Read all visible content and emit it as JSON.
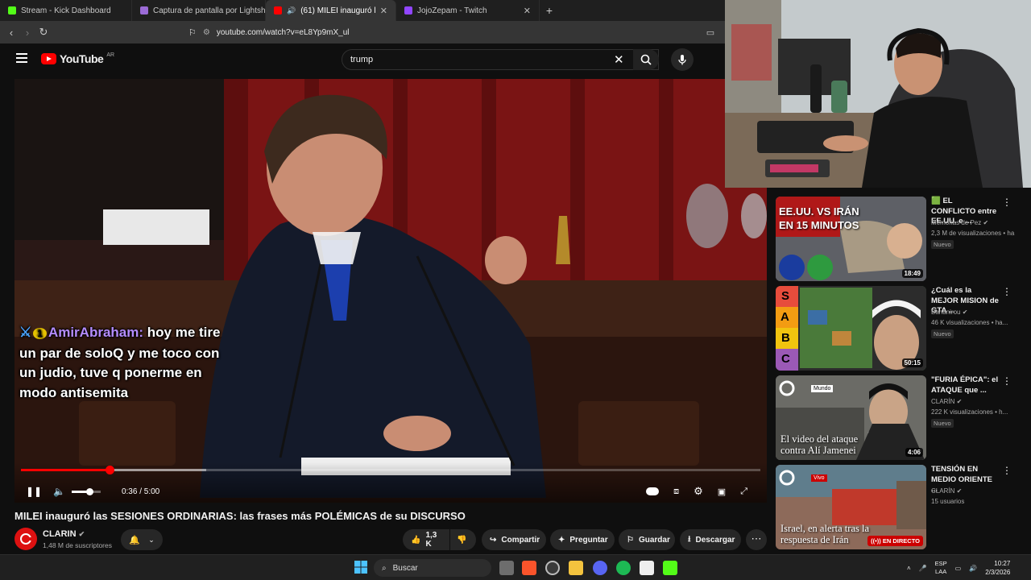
{
  "browser": {
    "tabs": [
      {
        "label": "Stream - Kick Dashboard",
        "icon": "kick-icon",
        "color": "#53fc18",
        "active": false
      },
      {
        "label": "Captura de pantalla por Lightshot",
        "icon": "feather-icon",
        "color": "#9b6bd6",
        "active": false
      },
      {
        "label": "(61) MILEI inauguró las SESIO",
        "icon": "youtube-icon",
        "color": "#ff0000",
        "active": true
      },
      {
        "label": "JojoZepam - Twitch",
        "icon": "twitch-icon",
        "color": "#9146ff",
        "active": false
      }
    ],
    "new_tab": "+",
    "url": "youtube.com/watch?v=eL8Yp9mX_ul"
  },
  "youtube": {
    "logo_text": "YouTube",
    "country": "AR",
    "search_value": "trump"
  },
  "player": {
    "time": "0:36 / 5:00",
    "played_fraction": 0.12,
    "buffered_fraction": 0.25,
    "volume_fraction": 0.6,
    "chat": {
      "user": "AmirAbraham:",
      "badge": "1",
      "message": " hoy me tire un par de soloQ y me toco con un judio, tuve q ponerme en modo antisemita"
    }
  },
  "video": {
    "title": "MILEI inauguró las SESIONES ORDINARIAS: las frases más POLÉMICAS de su DISCURSO",
    "channel": "CLARIN",
    "subscribers": "1,48 M de suscriptores",
    "likes": "1,3 K",
    "actions": {
      "share": "Compartir",
      "ask": "Preguntar",
      "save": "Guardar",
      "download": "Descargar"
    }
  },
  "recommendations": [
    {
      "title": "🟩 EL CONFLICTO entre EE.UU. e ...",
      "channel": "Memorias de Pez",
      "views": "2,3 M de visualizaciones • ha",
      "badge": "Nuevo",
      "duration": "18:49",
      "thumb_text": "EE.UU. VS IRÁN EN 15 MINUTOS"
    },
    {
      "title": "¿Cuál es la MEJOR MISION de GTA ...",
      "channel": "Bananirou",
      "views": "46 K visualizaciones • ha...",
      "badge": "Nuevo",
      "duration": "50:15",
      "tier_letters": [
        "S",
        "A",
        "B",
        "C"
      ]
    },
    {
      "title": "\"FURIA ÉPICA\": el ATAQUE que ...",
      "channel": "CLARÍN",
      "views": "222 K visualizaciones • h...",
      "badge": "Nuevo",
      "duration": "4:06",
      "thumb_tag": "Mundo",
      "thumb_text": "El video del ataque contra Alí Jamenei"
    },
    {
      "title": "TENSIÓN EN MEDIO ORIENTE ...",
      "channel": "CLARÍN",
      "views": "15 usuarios",
      "badge": "",
      "live": "EN DIRECTO",
      "thumb_tag": "Vivo",
      "thumb_text": "Israel, en alerta tras la respuesta de Irán"
    }
  ],
  "taskbar": {
    "search_label": "Buscar",
    "lang_top": "ESP",
    "lang_bottom": "LAA",
    "time": "10:27",
    "date": "2/3/2026"
  },
  "colors": {
    "accent": "#ff0000",
    "chat_username": "#b48cff",
    "live": "#cc0000"
  }
}
